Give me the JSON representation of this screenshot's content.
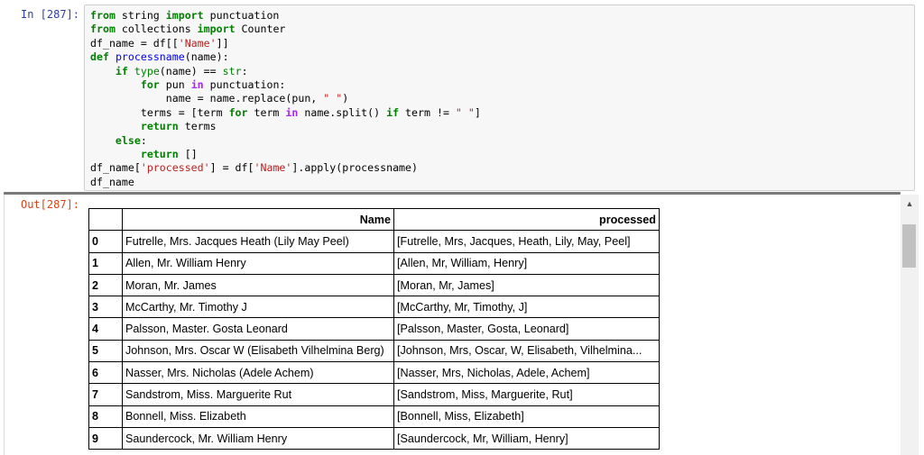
{
  "input_cell": {
    "prompt": "In [287]:",
    "code_lines": [
      [
        {
          "t": "from",
          "c": "kw"
        },
        {
          "t": " string "
        },
        {
          "t": "import",
          "c": "kw"
        },
        {
          "t": " punctuation"
        }
      ],
      [
        {
          "t": "from",
          "c": "kw"
        },
        {
          "t": " collections "
        },
        {
          "t": "import",
          "c": "kw"
        },
        {
          "t": " Counter"
        }
      ],
      [
        {
          "t": "df_name = df[["
        },
        {
          "t": "'Name'",
          "c": "st"
        },
        {
          "t": "]]"
        }
      ],
      [
        {
          "t": "def",
          "c": "kw"
        },
        {
          "t": " "
        },
        {
          "t": "processname",
          "c": "fn"
        },
        {
          "t": "(name):"
        }
      ],
      [
        {
          "t": "    "
        },
        {
          "t": "if",
          "c": "kw"
        },
        {
          "t": " "
        },
        {
          "t": "type",
          "c": "bi"
        },
        {
          "t": "(name) == "
        },
        {
          "t": "str",
          "c": "bi"
        },
        {
          "t": ":"
        }
      ],
      [
        {
          "t": "        "
        },
        {
          "t": "for",
          "c": "kw"
        },
        {
          "t": " pun "
        },
        {
          "t": "in",
          "c": "op"
        },
        {
          "t": " punctuation:"
        }
      ],
      [
        {
          "t": "            name = name.replace(pun, "
        },
        {
          "t": "\" \"",
          "c": "st"
        },
        {
          "t": ")"
        }
      ],
      [
        {
          "t": "        terms = [term "
        },
        {
          "t": "for",
          "c": "kw"
        },
        {
          "t": " term "
        },
        {
          "t": "in",
          "c": "op"
        },
        {
          "t": " name.split() "
        },
        {
          "t": "if",
          "c": "kw"
        },
        {
          "t": " term != "
        },
        {
          "t": "\" \"",
          "c": "st"
        },
        {
          "t": "]"
        }
      ],
      [
        {
          "t": "        "
        },
        {
          "t": "return",
          "c": "kw"
        },
        {
          "t": " terms"
        }
      ],
      [
        {
          "t": "    "
        },
        {
          "t": "else",
          "c": "kw"
        },
        {
          "t": ":"
        }
      ],
      [
        {
          "t": "        "
        },
        {
          "t": "return",
          "c": "kw"
        },
        {
          "t": " []"
        }
      ],
      [
        {
          "t": "df_name["
        },
        {
          "t": "'processed'",
          "c": "st"
        },
        {
          "t": "] = df["
        },
        {
          "t": "'Name'",
          "c": "st"
        },
        {
          "t": "].apply(processname)"
        }
      ],
      [
        {
          "t": "df_name"
        }
      ]
    ]
  },
  "output_cell": {
    "prompt": "Out[287]:",
    "table": {
      "headers": [
        "",
        "Name",
        "processed"
      ],
      "rows": [
        {
          "idx": "0",
          "name": "Futrelle, Mrs. Jacques Heath (Lily May Peel)",
          "processed": "[Futrelle, Mrs, Jacques, Heath, Lily, May, Peel]"
        },
        {
          "idx": "1",
          "name": "Allen, Mr. William Henry",
          "processed": "[Allen, Mr, William, Henry]"
        },
        {
          "idx": "2",
          "name": "Moran, Mr. James",
          "processed": "[Moran, Mr, James]"
        },
        {
          "idx": "3",
          "name": "McCarthy, Mr. Timothy J",
          "processed": "[McCarthy, Mr, Timothy, J]"
        },
        {
          "idx": "4",
          "name": "Palsson, Master. Gosta Leonard",
          "processed": "[Palsson, Master, Gosta, Leonard]"
        },
        {
          "idx": "5",
          "name": "Johnson, Mrs. Oscar W (Elisabeth Vilhelmina Berg)",
          "processed": "[Johnson, Mrs, Oscar, W, Elisabeth, Vilhelmina..."
        },
        {
          "idx": "6",
          "name": "Nasser, Mrs. Nicholas (Adele Achem)",
          "processed": "[Nasser, Mrs, Nicholas, Adele, Achem]"
        },
        {
          "idx": "7",
          "name": "Sandstrom, Miss. Marguerite Rut",
          "processed": "[Sandstrom, Miss, Marguerite, Rut]"
        },
        {
          "idx": "8",
          "name": "Bonnell, Miss. Elizabeth",
          "processed": "[Bonnell, Miss, Elizabeth]"
        },
        {
          "idx": "9",
          "name": "Saundercock, Mr. William Henry",
          "processed": "[Saundercock, Mr, William, Henry]"
        }
      ]
    }
  },
  "scrollbar": {
    "up_arrow_icon": "triangle-up"
  }
}
